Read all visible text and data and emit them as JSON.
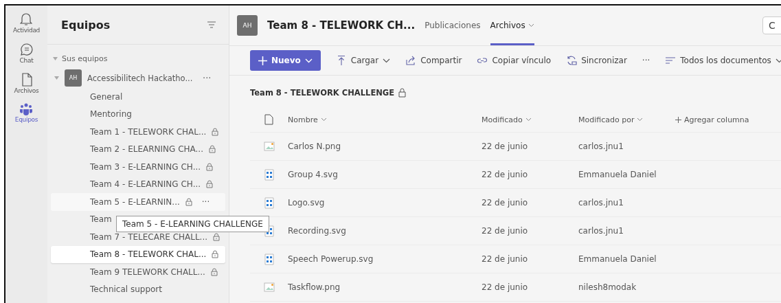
{
  "rail": [
    {
      "label": "Actividad",
      "selected": false
    },
    {
      "label": "Chat",
      "selected": false
    },
    {
      "label": "Archivos",
      "selected": false
    },
    {
      "label": "Equipos",
      "selected": true
    }
  ],
  "teams_panel": {
    "title": "Equipos",
    "section": "Sus equipos",
    "team": {
      "avatar": "AH",
      "name": "Accessibilitech Hackatho...",
      "more": "···"
    },
    "channels": [
      {
        "name": "General",
        "locked": false,
        "selected": false
      },
      {
        "name": "Mentoring",
        "locked": false,
        "selected": false
      },
      {
        "name": "Team 1 - TELEWORK CHAL...",
        "locked": true,
        "selected": false
      },
      {
        "name": "Team 2 - ELEARNING CHA...",
        "locked": true,
        "selected": false
      },
      {
        "name": "Team 3 - E-LEARNING CH...",
        "locked": true,
        "selected": false
      },
      {
        "name": "Team 4 - E-LEARNING CH...",
        "locked": true,
        "selected": false
      },
      {
        "name": "Team 5 - E-LEARNIN...",
        "locked": true,
        "selected": false,
        "more": "···"
      },
      {
        "name": "Team",
        "locked": false,
        "selected": false
      },
      {
        "name": "Team 7 - TELECARE CHALL...",
        "locked": true,
        "selected": false
      },
      {
        "name": "Team 8 - TELEWORK CHAL...",
        "locked": true,
        "selected": true
      },
      {
        "name": "Team 9 TELEWORK CHALL...",
        "locked": true,
        "selected": false
      },
      {
        "name": "Technical support",
        "locked": false,
        "selected": false
      }
    ],
    "tooltip": "Team 5 - E-LEARNING CHALLENGE"
  },
  "header": {
    "avatar": "AH",
    "title": "Team 8 - TELEWORK CH...",
    "tabs": [
      {
        "label": "Publicaciones",
        "selected": false,
        "dropdown": false
      },
      {
        "label": "Archivos",
        "selected": true,
        "dropdown": true
      }
    ],
    "side_button": "C"
  },
  "toolbar": [
    {
      "kind": "primary",
      "label": "Nuevo"
    },
    {
      "kind": "dropdown",
      "label": "Cargar"
    },
    {
      "kind": "plain",
      "label": "Compartir"
    },
    {
      "kind": "plain",
      "label": "Copiar vínculo"
    },
    {
      "kind": "plain",
      "label": "Sincronizar"
    },
    {
      "kind": "more",
      "label": "···"
    },
    {
      "kind": "dropdown",
      "label": "Todos los documentos"
    }
  ],
  "breadcrumb": {
    "label": "Team 8 - TELEWORK CHALLENGE",
    "locked": true
  },
  "table": {
    "columns": [
      "Nombre",
      "Modificado",
      "Modificado por",
      "Agregar columna"
    ],
    "rows": [
      {
        "kind": "image",
        "name": "Carlos N.png",
        "modified": "22 de junio",
        "modified_by": "carlos.jnu1"
      },
      {
        "kind": "vector",
        "name": "Group 4.svg",
        "modified": "22 de junio",
        "modified_by": "Emmanuela Daniel"
      },
      {
        "kind": "vector",
        "name": "Logo.svg",
        "modified": "22 de junio",
        "modified_by": "carlos.jnu1"
      },
      {
        "kind": "vector",
        "name": "Recording.svg",
        "modified": "22 de junio",
        "modified_by": "carlos.jnu1"
      },
      {
        "kind": "vector",
        "name": "Speech Powerup.svg",
        "modified": "22 de junio",
        "modified_by": "Emmanuela Daniel"
      },
      {
        "kind": "image",
        "name": "Taskflow.png",
        "modified": "22 de junio",
        "modified_by": "nilesh8modak"
      }
    ]
  }
}
